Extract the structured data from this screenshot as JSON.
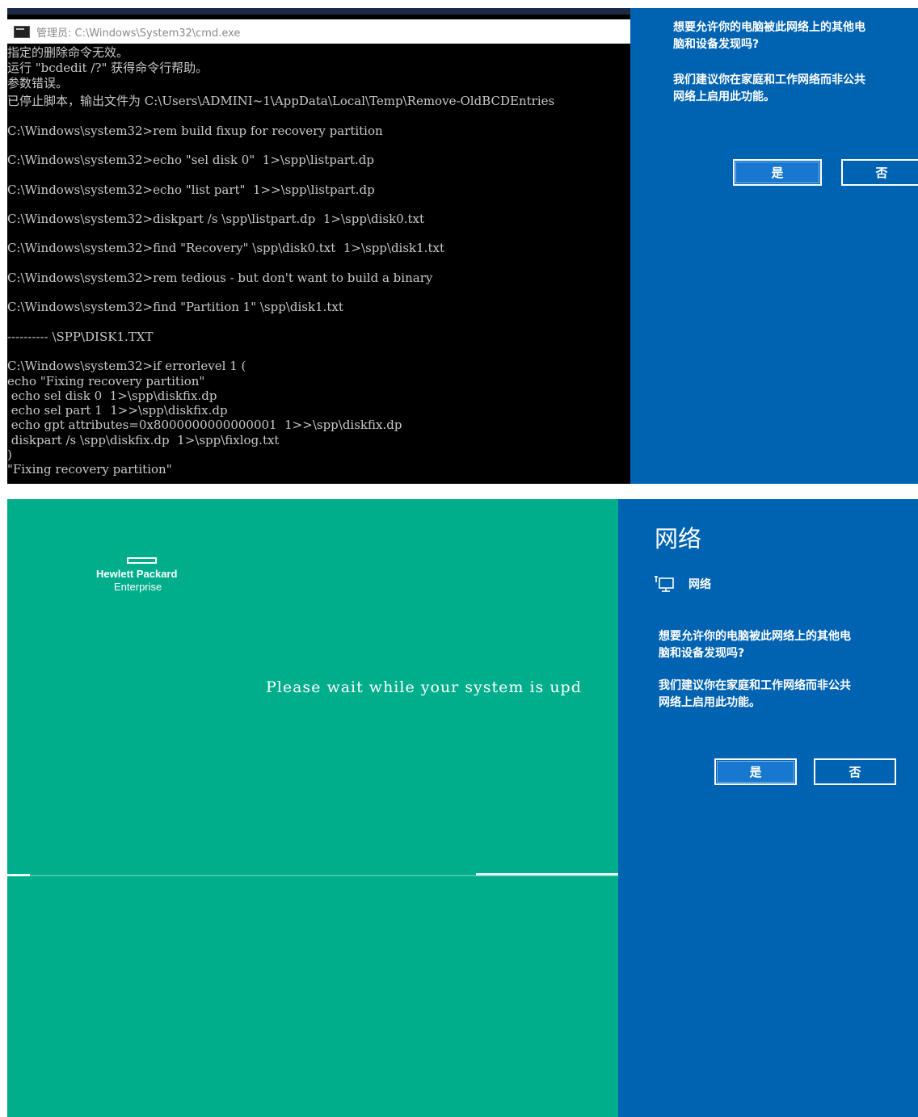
{
  "top_screen": {
    "cmd": {
      "title": "管理员: C:\\Windows\\System32\\cmd.exe",
      "lines": [
        "指定的删除命令无效。",
        "运行 \"bcdedit /?\" 获得命令行帮助。",
        "参数错误。",
        "已停止脚本，输出文件为 C:\\Users\\ADMINI~1\\AppData\\Local\\Temp\\Remove-OldBCDEntries",
        "C:\\Windows\\system32>rem build fixup for recovery partition",
        "C:\\Windows\\system32>echo \"sel disk 0\"  1>\\spp\\listpart.dp",
        "C:\\Windows\\system32>echo \"list part\"  1>>\\spp\\listpart.dp",
        "C:\\Windows\\system32>diskpart /s \\spp\\listpart.dp  1>\\spp\\disk0.txt",
        "C:\\Windows\\system32>find \"Recovery\" \\spp\\disk0.txt  1>\\spp\\disk1.txt",
        "C:\\Windows\\system32>rem tedious - but don't want to build a binary",
        "C:\\Windows\\system32>find \"Partition 1\" \\spp\\disk1.txt",
        "---------- \\SPP\\DISK1.TXT",
        "C:\\Windows\\system32>if errorlevel 1 (",
        "echo \"Fixing recovery partition\"",
        " echo sel disk 0  1>\\spp\\diskfix.dp",
        " echo sel part 1  1>>\\spp\\diskfix.dp",
        " echo gpt attributes=0x8000000000000001  1>>\\spp\\diskfix.dp",
        " diskpart /s \\spp\\diskfix.dp  1>\\spp\\fixlog.txt",
        ")",
        "\"Fixing recovery partition\""
      ]
    },
    "dialog": {
      "question": "想要允许你的电脑被此网络上的其他电",
      "question_line2": "脑和设备发现吗?",
      "recommend": "我们建议你在家庭和工作网络而非公共",
      "recommend_line2": "网络上启用此功能。",
      "yes_label": "是",
      "no_label": "否"
    }
  },
  "bottom_screen": {
    "logo": {
      "line1": "Hewlett Packard",
      "line2": "Enterprise"
    },
    "wait_message": "Please wait while your system is upd",
    "network_panel": {
      "heading": "网络",
      "network_name": "网络",
      "question": "想要允许你的电脑被此网络上的其他电",
      "question_line2": "脑和设备发现吗?",
      "recommend": "我们建议你在家庭和工作网络而非公共",
      "recommend_line2": "网络上启用此功能。",
      "yes_label": "是",
      "no_label": "否"
    }
  },
  "colors": {
    "dialog_blue": "#0063b1",
    "hpe_green": "#00ae8c",
    "console_text": "#c9c9c9"
  }
}
